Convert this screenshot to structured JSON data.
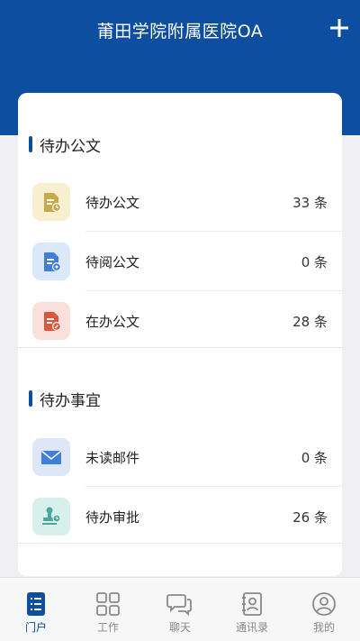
{
  "header": {
    "title": "莆田学院附属医院OA",
    "add_icon": "plus-icon"
  },
  "sections": [
    {
      "title": "待办公文",
      "items": [
        {
          "label": "待办公文",
          "count": "33 条",
          "icon": "document-clock-icon",
          "icon_color": "#c9a84a",
          "icon_bg": "#f7efcf"
        },
        {
          "label": "待阅公文",
          "count": "0 条",
          "icon": "document-eye-icon",
          "icon_color": "#3f7fd9",
          "icon_bg": "#dbe8f8"
        },
        {
          "label": "在办公文",
          "count": "28 条",
          "icon": "document-edit-icon",
          "icon_color": "#d9573f",
          "icon_bg": "#f9e0da"
        }
      ]
    },
    {
      "title": "待办事宜",
      "items": [
        {
          "label": "未读邮件",
          "count": "0 条",
          "icon": "mail-icon",
          "icon_color": "#3f7fd9",
          "icon_bg": "#dde7f8"
        },
        {
          "label": "待办审批",
          "count": "26 条",
          "icon": "stamp-icon",
          "icon_color": "#4aa89a",
          "icon_bg": "#d8f0ec"
        }
      ]
    }
  ],
  "tabs": [
    {
      "label": "门户",
      "icon": "portal-icon",
      "active": true
    },
    {
      "label": "工作",
      "icon": "grid-icon",
      "active": false
    },
    {
      "label": "聊天",
      "icon": "chat-icon",
      "active": false
    },
    {
      "label": "通讯录",
      "icon": "contacts-icon",
      "active": false
    },
    {
      "label": "我的",
      "icon": "profile-icon",
      "active": false
    }
  ],
  "colors": {
    "brand": "#0d4ea1",
    "background": "#f0eff4"
  }
}
